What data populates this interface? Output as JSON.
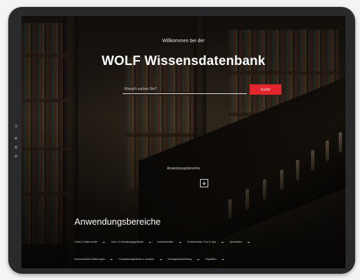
{
  "hero": {
    "welcome": "Willkommen bei der",
    "title": "WOLF Wissensdatenbank"
  },
  "search": {
    "placeholder": "Wonach suchen Sie?",
    "button_label": "Suche"
  },
  "scroll": {
    "label": "Anwendungsbereiche",
    "icon": "arrow-down-icon"
  },
  "section": {
    "title": "Anwendungsbereiche"
  },
  "categories_row1": [
    "Hotel & Gastronomie",
    "Büro- & Verwaltungsgebäude",
    "Industriehallen",
    "Schwimmbad, Pool & Spa",
    "Sporthallen"
  ],
  "categories_row2": [
    "Kommerzielles Erfahrungen",
    "Produktionsgebäude & Industrie",
    "Wohngebäudelüftung",
    "Flughäfen"
  ],
  "colors": {
    "accent": "#e3262b",
    "text": "#ffffff",
    "device": "#2a2a2c"
  }
}
